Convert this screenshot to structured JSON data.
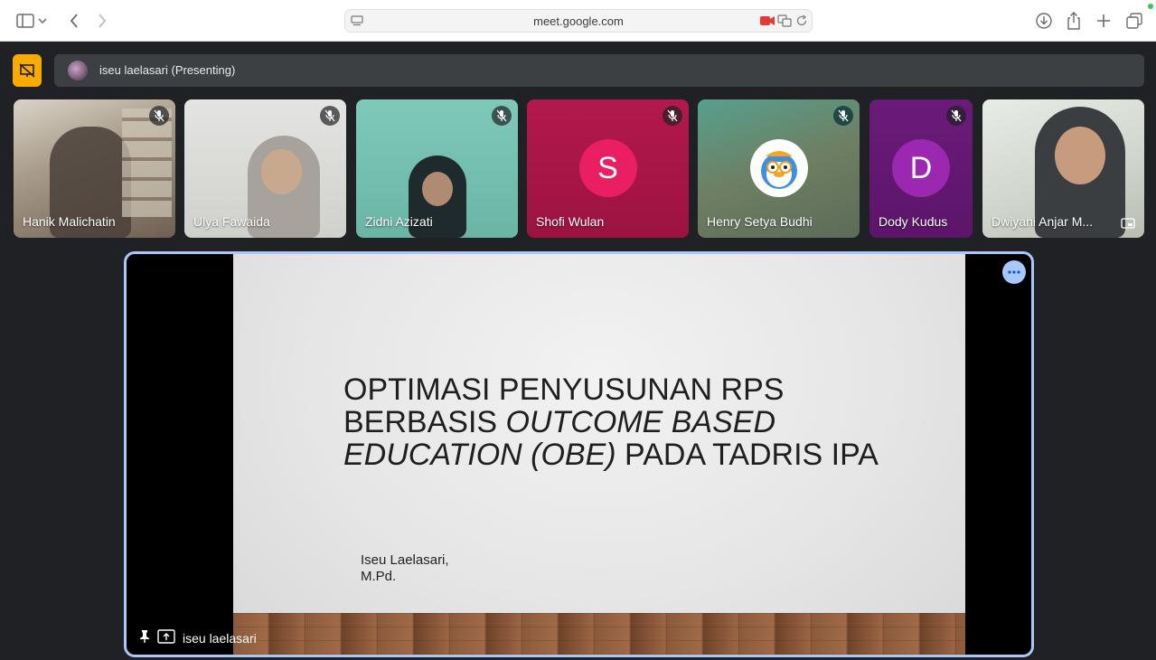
{
  "browser": {
    "url": "meet.google.com"
  },
  "presenting_bar": {
    "label": "iseu laelasari (Presenting)"
  },
  "participants": [
    {
      "name": "Hanik Malichatin",
      "muted": true
    },
    {
      "name": "Ulya Fawaida",
      "muted": true
    },
    {
      "name": "Zidni Azizati",
      "muted": true
    },
    {
      "name": "Shofi Wulan",
      "muted": true,
      "initial": "S",
      "avatar_color": "#e91e63"
    },
    {
      "name": "Henry Setya Budhi",
      "muted": true
    },
    {
      "name": "Dody Kudus",
      "muted": true,
      "initial": "D",
      "avatar_color": "#9c27b0"
    },
    {
      "name": "Dwiyani Anjar M...",
      "muted": false
    }
  ],
  "slide": {
    "title_line1": "OPTIMASI PENYUSUNAN RPS",
    "title_line2_normal": "BERBASIS ",
    "title_line2_italic": "OUTCOME BASED",
    "title_line3_italic": "EDUCATION (OBE)",
    "title_line3_normal": " PADA TADRIS IPA",
    "author_line1": "Iseu Laelasari,",
    "author_line2": "M.Pd."
  },
  "stage": {
    "presenter_label": "iseu laelasari"
  },
  "colors": {
    "accent_present": "#f9ab00",
    "stage_border": "#a8c7fa"
  }
}
